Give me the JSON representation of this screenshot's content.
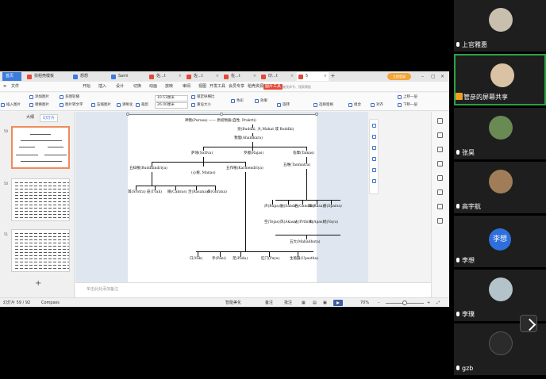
{
  "tabs": [
    {
      "label": "首页",
      "kind": "home"
    },
    {
      "label": "找稻壳模板",
      "color": "#e24a3b"
    },
    {
      "label": "想想",
      "color": "#3b7cde"
    },
    {
      "label": "Sami",
      "color": "#3b7cde"
    },
    {
      "label": "佐...t",
      "color": "#e24a3b"
    },
    {
      "label": "佐...t",
      "color": "#e24a3b"
    },
    {
      "label": "佐...t",
      "color": "#e24a3b"
    },
    {
      "label": "印...t",
      "color": "#e24a3b"
    },
    {
      "label": "5",
      "color": "#e24a3b",
      "active": true
    }
  ],
  "login_button": "立即登录",
  "menu": [
    "文件",
    "开始",
    "插入",
    "设计",
    "切换",
    "动画",
    "放映",
    "审阅",
    "视图",
    "开发工具",
    "会员专享",
    "稻壳资源",
    "图片工具"
  ],
  "active_menu": "图片工具",
  "search_placeholder": "查找命令、搜索模板",
  "ribbon": {
    "add_image": "添加图片",
    "multi_image": "多图轮播",
    "insert_image": "插入图片",
    "replace_image": "替换图片",
    "compress_image": "压缩图片",
    "clarity": "清晰化",
    "image_to_text": "图片转文字",
    "crop": "裁剪",
    "width": "10.53厘米",
    "height": "26.00厘米",
    "lock_ratio": "锁定纵横比",
    "reset_size": "重设大小",
    "color": "色彩",
    "effect": "效果",
    "rotate": "旋转",
    "combine": "组合",
    "select_pane": "选择窗格",
    "align": "对齐",
    "bring_forward": "上移一层",
    "send_backward": "下移一层"
  },
  "sidebar": {
    "tab_outline": "大纲",
    "tab_slides": "幻灯片",
    "slides": [
      {
        "num": "50"
      },
      {
        "num": "50"
      },
      {
        "num": "51"
      }
    ]
  },
  "diagram": {
    "root": "神我(Purusa) —— 原初物质(自性, Prakrti)",
    "mahat": "觉(Buddhi, 大,Mahat 或 Buddhi)",
    "ahamkara": "我慢(Ahamkara)",
    "sattva": "萨埵(Sattva)",
    "rajas": "罗阇(Rajas)",
    "tamas": "答摩(Tamas)",
    "buddhindriya": "五知根(Buddhindriya)",
    "manas": "(心根, Manas)",
    "karmendriya": "五作根(Karmendriya)",
    "tanmatra": "五唯(Tanmatra)",
    "senses": [
      "耳(Srotra)",
      "皮(Tvak)",
      "眼(Caksus)",
      "舌(Rasana)",
      "鼻(Ghrana)"
    ],
    "tanmatras": [
      "声(Rupa)",
      "触(Sabda)",
      "色(Gandha)",
      "味(Rasa)",
      "香(Sparsa)"
    ],
    "elements": [
      "空(Tejas)",
      "风(Akasa)",
      "火(Prthivi)",
      "水(Apas)",
      "地(Vayu)"
    ],
    "mahabhuta": "五大(Mahabhuta)",
    "actions": [
      "口(Vak)",
      "手(Pani)",
      "足(Pada)",
      "肛门(Payu)",
      "生殖器(Upastha)"
    ]
  },
  "notes_placeholder": "单击此处添加备注",
  "status": {
    "slide_counter": "幻灯片 59 / 92",
    "theme": "Compass",
    "smart_beautify": "智能美化",
    "notes": "备注",
    "comments": "批注",
    "zoom": "70%"
  },
  "participants": [
    {
      "name": "上官雅惠",
      "kind": "photo",
      "color": "#c8bfae"
    },
    {
      "name": "管彦的屏幕共享",
      "kind": "photo",
      "color": "#d9c3a4",
      "speaking": true
    },
    {
      "name": "张昊",
      "kind": "photo",
      "color": "#6a8a54"
    },
    {
      "name": "高宇航",
      "kind": "photo",
      "color": "#a07d58"
    },
    {
      "name": "李想",
      "kind": "letter",
      "letter": "李想"
    },
    {
      "name": "李璞",
      "kind": "photo",
      "color": "#b4c2c9"
    },
    {
      "name": "gzb",
      "kind": "icon"
    }
  ]
}
